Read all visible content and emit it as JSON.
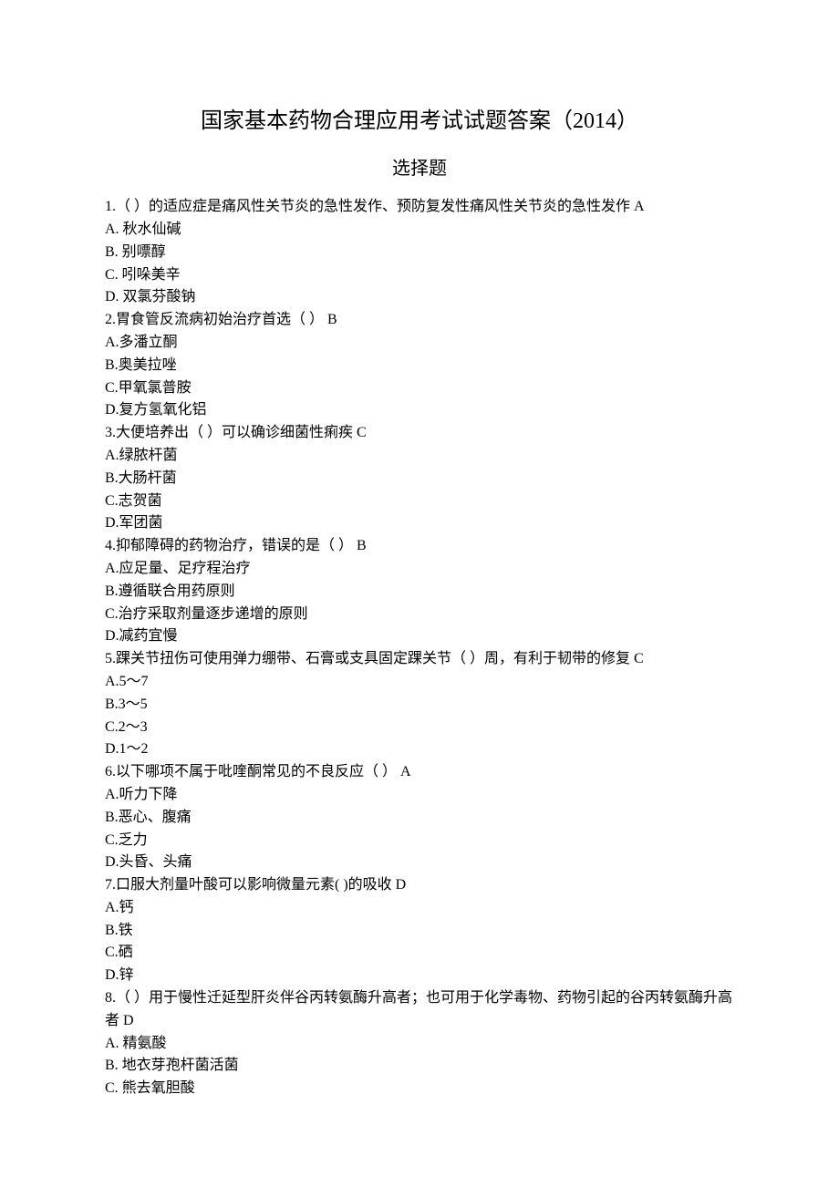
{
  "title": "国家基本药物合理应用考试试题答案（2014）",
  "subtitle": "选择题",
  "questions": [
    {
      "stem": "1.（ ）的适应症是痛风性关节炎的急性发作、预防复发性痛风性关节炎的急性发作  A",
      "options": [
        "A.  秋水仙碱",
        "B.  别嘌醇",
        "C.  吲哚美辛",
        "D.  双氯芬酸钠"
      ]
    },
    {
      "stem": "2.胃食管反流病初始治疗首选（  ）  B",
      "options": [
        "A.多潘立酮",
        "B.奥美拉唑",
        "C.甲氧氯普胺",
        "D.复方氢氧化铝"
      ]
    },
    {
      "stem": "3.大便培养出（  ）可以确诊细菌性痢疾  C",
      "options": [
        "A.绿脓杆菌",
        "B.大肠杆菌",
        "C.志贺菌",
        "D.军团菌"
      ]
    },
    {
      "stem": "4.抑郁障碍的药物治疗，错误的是（  ）  B",
      "options": [
        "A.应足量、足疗程治疗",
        "B.遵循联合用药原则",
        "C.治疗采取剂量逐步递增的原则",
        "D.减药宜慢"
      ]
    },
    {
      "stem": "5.踝关节扭伤可使用弹力绷带、石膏或支具固定踝关节（  ）周，有利于韧带的修复  C",
      "options": [
        "A.5～7",
        "B.3～5",
        "C.2～3",
        "D.1～2"
      ]
    },
    {
      "stem": "6.以下哪项不属于吡喹酮常见的不良反应（  ）  A",
      "options": [
        "A.听力下降",
        "B.恶心、腹痛",
        "C.乏力",
        "D.头昏、头痛"
      ]
    },
    {
      "stem": "7.口服大剂量叶酸可以影响微量元素(  )的吸收  D",
      "options": [
        "A.钙",
        "B.铁",
        "C.硒",
        "D.锌"
      ]
    },
    {
      "stem": "8.（  ）用于慢性迁延型肝炎伴谷丙转氨酶升高者；也可用于化学毒物、药物引起的谷丙转氨酶升高者  D",
      "options": [
        "A.  精氨酸",
        "B.  地衣芽孢杆菌活菌",
        "C.  熊去氧胆酸"
      ]
    }
  ]
}
